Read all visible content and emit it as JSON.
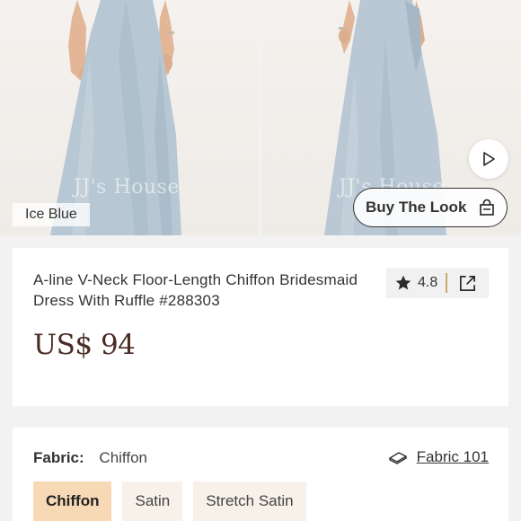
{
  "gallery": {
    "watermark": "JJ's House",
    "color_label": "Ice Blue",
    "buy_the_look": "Buy The Look",
    "icons": {
      "play": "play-icon",
      "bag": "shopping-bag-icon"
    }
  },
  "product": {
    "title": "A-line V-Neck Floor-Length Chiffon Bridesmaid Dress With Ruffle #288303",
    "rating": "4.8",
    "price": "US$ 94",
    "icons": {
      "rating": "star-icon",
      "share": "share-icon"
    },
    "colors": {
      "price": "#4a2c27",
      "rating_divider": "#c9a86e"
    }
  },
  "fabric": {
    "label": "Fabric:",
    "value": "Chiffon",
    "guide_link": "Fabric 101",
    "options": [
      {
        "label": "Chiffon",
        "selected": true
      },
      {
        "label": "Satin",
        "selected": false
      },
      {
        "label": "Stretch Satin",
        "selected": false
      }
    ],
    "colors": {
      "selected_bg": "#f8d9b5",
      "option_bg": "#f7f1ea"
    }
  }
}
